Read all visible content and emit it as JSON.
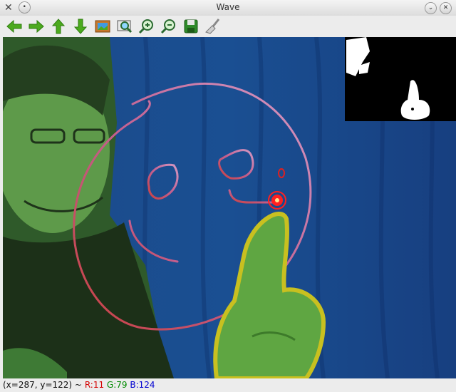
{
  "window": {
    "title": "Wave"
  },
  "toolbar": {
    "tools": [
      {
        "name": "back-arrow-icon",
        "tip": "Pan left"
      },
      {
        "name": "forward-arrow-icon",
        "tip": "Pan right"
      },
      {
        "name": "up-arrow-icon",
        "tip": "Pan up"
      },
      {
        "name": "down-arrow-icon",
        "tip": "Pan down"
      },
      {
        "name": "image-icon",
        "tip": "Zoom to original size"
      },
      {
        "name": "zoom-fit-icon",
        "tip": "Zoom to window"
      },
      {
        "name": "zoom-in-icon",
        "tip": "Zoom in"
      },
      {
        "name": "zoom-out-icon",
        "tip": "Zoom out"
      },
      {
        "name": "save-icon",
        "tip": "Save"
      },
      {
        "name": "properties-brush-icon",
        "tip": "Properties"
      }
    ]
  },
  "status": {
    "coords": "(x=287, y=122) ~",
    "r": "R:11",
    "g": "G:79",
    "b": "B:124"
  },
  "colors": {
    "drawing_stroke": "#d48aa8",
    "hand_outline": "#c8c020",
    "tracker": "#ff2020"
  }
}
